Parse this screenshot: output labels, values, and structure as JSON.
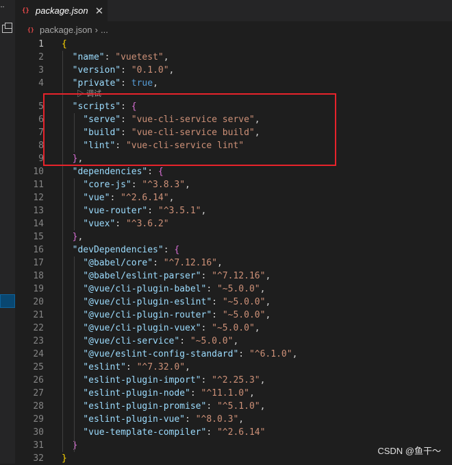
{
  "tab": {
    "label": "package.json",
    "icon": "json-icon",
    "close": "✕"
  },
  "breadcrumb": {
    "file": "package.json",
    "sep": "›",
    "more": "..."
  },
  "codelens": {
    "text": "▷ 调试"
  },
  "editor": {
    "lines": [
      {
        "n": "1",
        "tokens": [
          {
            "t": "{",
            "c": "b1"
          }
        ]
      },
      {
        "n": "2",
        "tokens": [
          {
            "t": "  \"name\"",
            "c": "k"
          },
          {
            "t": ": ",
            "c": "p"
          },
          {
            "t": "\"vuetest\"",
            "c": "s"
          },
          {
            "t": ",",
            "c": "p"
          }
        ]
      },
      {
        "n": "3",
        "tokens": [
          {
            "t": "  \"version\"",
            "c": "k"
          },
          {
            "t": ": ",
            "c": "p"
          },
          {
            "t": "\"0.1.0\"",
            "c": "s"
          },
          {
            "t": ",",
            "c": "p"
          }
        ]
      },
      {
        "n": "4",
        "tokens": [
          {
            "t": "  \"private\"",
            "c": "k"
          },
          {
            "t": ": ",
            "c": "p"
          },
          {
            "t": "true",
            "c": "kw"
          },
          {
            "t": ",",
            "c": "p"
          }
        ]
      },
      {
        "n": "5",
        "tokens": [
          {
            "t": "  \"scripts\"",
            "c": "k"
          },
          {
            "t": ": ",
            "c": "p"
          },
          {
            "t": "{",
            "c": "b2"
          }
        ]
      },
      {
        "n": "6",
        "tokens": [
          {
            "t": "    \"serve\"",
            "c": "k"
          },
          {
            "t": ": ",
            "c": "p"
          },
          {
            "t": "\"vue-cli-service serve\"",
            "c": "s"
          },
          {
            "t": ",",
            "c": "p"
          }
        ]
      },
      {
        "n": "7",
        "tokens": [
          {
            "t": "    \"build\"",
            "c": "k"
          },
          {
            "t": ": ",
            "c": "p"
          },
          {
            "t": "\"vue-cli-service build\"",
            "c": "s"
          },
          {
            "t": ",",
            "c": "p"
          }
        ]
      },
      {
        "n": "8",
        "tokens": [
          {
            "t": "    \"lint\"",
            "c": "k"
          },
          {
            "t": ": ",
            "c": "p"
          },
          {
            "t": "\"vue-cli-service lint\"",
            "c": "s"
          }
        ]
      },
      {
        "n": "9",
        "tokens": [
          {
            "t": "  }",
            "c": "b2"
          },
          {
            "t": ",",
            "c": "p"
          }
        ]
      },
      {
        "n": "10",
        "tokens": [
          {
            "t": "  \"dependencies\"",
            "c": "k"
          },
          {
            "t": ": ",
            "c": "p"
          },
          {
            "t": "{",
            "c": "b2"
          }
        ]
      },
      {
        "n": "11",
        "tokens": [
          {
            "t": "    \"core-js\"",
            "c": "k"
          },
          {
            "t": ": ",
            "c": "p"
          },
          {
            "t": "\"^3.8.3\"",
            "c": "s"
          },
          {
            "t": ",",
            "c": "p"
          }
        ]
      },
      {
        "n": "12",
        "tokens": [
          {
            "t": "    \"vue\"",
            "c": "k"
          },
          {
            "t": ": ",
            "c": "p"
          },
          {
            "t": "\"^2.6.14\"",
            "c": "s"
          },
          {
            "t": ",",
            "c": "p"
          }
        ]
      },
      {
        "n": "13",
        "tokens": [
          {
            "t": "    \"vue-router\"",
            "c": "k"
          },
          {
            "t": ": ",
            "c": "p"
          },
          {
            "t": "\"^3.5.1\"",
            "c": "s"
          },
          {
            "t": ",",
            "c": "p"
          }
        ]
      },
      {
        "n": "14",
        "tokens": [
          {
            "t": "    \"vuex\"",
            "c": "k"
          },
          {
            "t": ": ",
            "c": "p"
          },
          {
            "t": "\"^3.6.2\"",
            "c": "s"
          }
        ]
      },
      {
        "n": "15",
        "tokens": [
          {
            "t": "  }",
            "c": "b2"
          },
          {
            "t": ",",
            "c": "p"
          }
        ]
      },
      {
        "n": "16",
        "tokens": [
          {
            "t": "  \"devDependencies\"",
            "c": "k"
          },
          {
            "t": ": ",
            "c": "p"
          },
          {
            "t": "{",
            "c": "b2"
          }
        ]
      },
      {
        "n": "17",
        "tokens": [
          {
            "t": "    \"@babel/core\"",
            "c": "k"
          },
          {
            "t": ": ",
            "c": "p"
          },
          {
            "t": "\"^7.12.16\"",
            "c": "s"
          },
          {
            "t": ",",
            "c": "p"
          }
        ]
      },
      {
        "n": "18",
        "tokens": [
          {
            "t": "    \"@babel/eslint-parser\"",
            "c": "k"
          },
          {
            "t": ": ",
            "c": "p"
          },
          {
            "t": "\"^7.12.16\"",
            "c": "s"
          },
          {
            "t": ",",
            "c": "p"
          }
        ]
      },
      {
        "n": "19",
        "tokens": [
          {
            "t": "    \"@vue/cli-plugin-babel\"",
            "c": "k"
          },
          {
            "t": ": ",
            "c": "p"
          },
          {
            "t": "\"~5.0.0\"",
            "c": "s"
          },
          {
            "t": ",",
            "c": "p"
          }
        ]
      },
      {
        "n": "20",
        "tokens": [
          {
            "t": "    \"@vue/cli-plugin-eslint\"",
            "c": "k"
          },
          {
            "t": ": ",
            "c": "p"
          },
          {
            "t": "\"~5.0.0\"",
            "c": "s"
          },
          {
            "t": ",",
            "c": "p"
          }
        ]
      },
      {
        "n": "21",
        "tokens": [
          {
            "t": "    \"@vue/cli-plugin-router\"",
            "c": "k"
          },
          {
            "t": ": ",
            "c": "p"
          },
          {
            "t": "\"~5.0.0\"",
            "c": "s"
          },
          {
            "t": ",",
            "c": "p"
          }
        ]
      },
      {
        "n": "22",
        "tokens": [
          {
            "t": "    \"@vue/cli-plugin-vuex\"",
            "c": "k"
          },
          {
            "t": ": ",
            "c": "p"
          },
          {
            "t": "\"~5.0.0\"",
            "c": "s"
          },
          {
            "t": ",",
            "c": "p"
          }
        ]
      },
      {
        "n": "23",
        "tokens": [
          {
            "t": "    \"@vue/cli-service\"",
            "c": "k"
          },
          {
            "t": ": ",
            "c": "p"
          },
          {
            "t": "\"~5.0.0\"",
            "c": "s"
          },
          {
            "t": ",",
            "c": "p"
          }
        ]
      },
      {
        "n": "24",
        "tokens": [
          {
            "t": "    \"@vue/eslint-config-standard\"",
            "c": "k"
          },
          {
            "t": ": ",
            "c": "p"
          },
          {
            "t": "\"^6.1.0\"",
            "c": "s"
          },
          {
            "t": ",",
            "c": "p"
          }
        ]
      },
      {
        "n": "25",
        "tokens": [
          {
            "t": "    \"eslint\"",
            "c": "k"
          },
          {
            "t": ": ",
            "c": "p"
          },
          {
            "t": "\"^7.32.0\"",
            "c": "s"
          },
          {
            "t": ",",
            "c": "p"
          }
        ]
      },
      {
        "n": "26",
        "tokens": [
          {
            "t": "    \"eslint-plugin-import\"",
            "c": "k"
          },
          {
            "t": ": ",
            "c": "p"
          },
          {
            "t": "\"^2.25.3\"",
            "c": "s"
          },
          {
            "t": ",",
            "c": "p"
          }
        ]
      },
      {
        "n": "27",
        "tokens": [
          {
            "t": "    \"eslint-plugin-node\"",
            "c": "k"
          },
          {
            "t": ": ",
            "c": "p"
          },
          {
            "t": "\"^11.1.0\"",
            "c": "s"
          },
          {
            "t": ",",
            "c": "p"
          }
        ]
      },
      {
        "n": "28",
        "tokens": [
          {
            "t": "    \"eslint-plugin-promise\"",
            "c": "k"
          },
          {
            "t": ": ",
            "c": "p"
          },
          {
            "t": "\"^5.1.0\"",
            "c": "s"
          },
          {
            "t": ",",
            "c": "p"
          }
        ]
      },
      {
        "n": "29",
        "tokens": [
          {
            "t": "    \"eslint-plugin-vue\"",
            "c": "k"
          },
          {
            "t": ": ",
            "c": "p"
          },
          {
            "t": "\"^8.0.3\"",
            "c": "s"
          },
          {
            "t": ",",
            "c": "p"
          }
        ]
      },
      {
        "n": "30",
        "tokens": [
          {
            "t": "    \"vue-template-compiler\"",
            "c": "k"
          },
          {
            "t": ": ",
            "c": "p"
          },
          {
            "t": "\"^2.6.14\"",
            "c": "s"
          }
        ]
      },
      {
        "n": "31",
        "tokens": [
          {
            "t": "  }",
            "c": "b2"
          }
        ]
      },
      {
        "n": "32",
        "tokens": [
          {
            "t": "}",
            "c": "b1"
          }
        ]
      }
    ]
  },
  "watermark": "CSDN @鱼干～",
  "colors": {
    "background": "#1e1e1e",
    "key": "#9cdcfe",
    "string": "#ce9178",
    "keyword": "#569cd6",
    "bracket_outer": "#ffd700",
    "bracket_inner": "#da70d6",
    "annotation_box": "#e8232b"
  }
}
